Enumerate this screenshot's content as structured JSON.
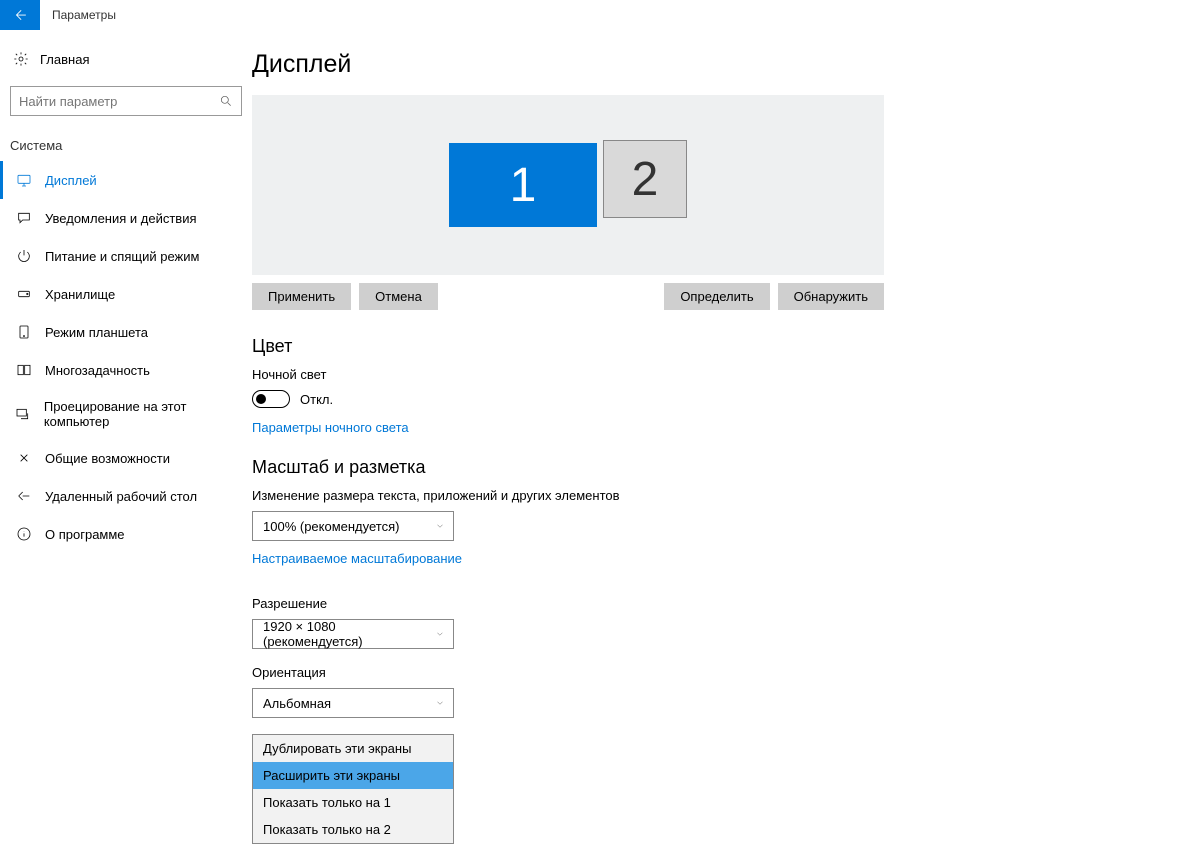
{
  "topbar": {
    "title": "Параметры"
  },
  "sidebar": {
    "home": "Главная",
    "search_placeholder": "Найти параметр",
    "section": "Система",
    "items": [
      {
        "label": "Дисплей"
      },
      {
        "label": "Уведомления и действия"
      },
      {
        "label": "Питание и спящий режим"
      },
      {
        "label": "Хранилище"
      },
      {
        "label": "Режим планшета"
      },
      {
        "label": "Многозадачность"
      },
      {
        "label": "Проецирование на этот компьютер"
      },
      {
        "label": "Общие возможности"
      },
      {
        "label": "Удаленный рабочий стол"
      },
      {
        "label": "О программе"
      }
    ]
  },
  "main": {
    "title": "Дисплей",
    "monitors": {
      "m1": "1",
      "m2": "2"
    },
    "buttons": {
      "apply": "Применить",
      "cancel": "Отмена",
      "identify": "Определить",
      "detect": "Обнаружить"
    },
    "color": {
      "heading": "Цвет",
      "night_label": "Ночной свет",
      "toggle_state": "Откл.",
      "night_link": "Параметры ночного света"
    },
    "scale": {
      "heading": "Масштаб и разметка",
      "scale_label": "Изменение размера текста, приложений и других элементов",
      "scale_value": "100% (рекомендуется)",
      "custom_link": "Настраиваемое масштабирование",
      "resolution_label": "Разрешение",
      "resolution_value": "1920 × 1080 (рекомендуется)",
      "orientation_label": "Ориентация",
      "orientation_value": "Альбомная"
    },
    "multi_dropdown": {
      "options": [
        "Дублировать эти экраны",
        "Расширить эти экраны",
        "Показать только на 1",
        "Показать только на 2"
      ],
      "selected_index": 1
    }
  }
}
